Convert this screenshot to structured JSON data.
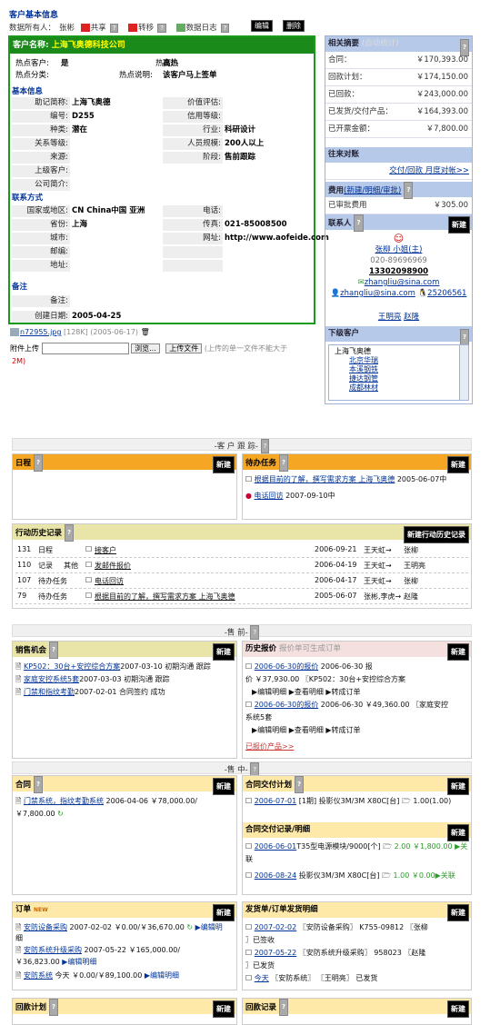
{
  "title": "客户基本信息",
  "topbar": {
    "owner_label": "数据所有人：",
    "owner": "张彬",
    "share": "共享",
    "transfer": "转移",
    "log": "数据日志",
    "edit": "编辑",
    "delete": "删除"
  },
  "customer": {
    "label": "客户名称:",
    "name": "上海飞奥德科技公司",
    "hot_customer_label": "热点客户:",
    "hot_customer": "是",
    "hotness_label": "热度:",
    "hotness": "高热",
    "hot_type_label": "热点分类:",
    "hot_desc_label": "热点说明:",
    "hot_desc": "该客户马上签单",
    "basic_title": "基本信息",
    "basic": [
      [
        "助记简称:",
        "上海飞奥德",
        "价值评估:",
        ""
      ],
      [
        "编号:",
        "D255",
        "信用等级:",
        ""
      ],
      [
        "种类:",
        "潜在",
        "行业:",
        "科研设计"
      ],
      [
        "关系等级:",
        "",
        "人员规模:",
        "200人以上"
      ],
      [
        "来源:",
        "",
        "阶段:",
        "售前跟踪"
      ],
      [
        "上级客户:",
        "",
        "",
        ""
      ],
      [
        "公司简介:",
        "",
        "",
        ""
      ]
    ],
    "contact_title": "联系方式",
    "contact": [
      [
        "国家或地区:",
        "CN China中国  亚洲",
        "电话:",
        ""
      ],
      [
        "省份:",
        "上海",
        "传真:",
        "021-85008500"
      ],
      [
        "城市:",
        "",
        "网址:",
        "http://www.aofeide.com"
      ],
      [
        "邮编:",
        "",
        "",
        ""
      ],
      [
        "地址:",
        "",
        "",
        ""
      ]
    ],
    "note_title": "备注",
    "note_label": "备注:",
    "created_label": "创建日期:",
    "created": "2005-04-25"
  },
  "attachment": {
    "file": "n72955.jpg",
    "meta": "[128K] (2005-06-17)",
    "upload_label": "附件上传",
    "browse": "浏览...",
    "upload_btn": "上传文件",
    "hint": "(上传的单一文件不能大于",
    "hint2": "2M)"
  },
  "side": {
    "summary_title": "相关摘要",
    "summary_sub": "(自动统计)",
    "summary": [
      [
        "合同：",
        "￥170,393.00"
      ],
      [
        "回款计划：",
        "￥174,150.00"
      ],
      [
        "已回款：",
        "￥243,000.00"
      ],
      [
        "已发货/交付产品：",
        "￥164,393.00"
      ],
      [
        "已开票金额：",
        "￥7,800.00"
      ]
    ],
    "contact_title": "往来对账",
    "contact_link": "交付/回款  月度对帐>>",
    "fee_title": "费用",
    "fee_sub": "(新建/明细/审批)",
    "fee_label": "已审批费用",
    "fee_value": "￥305.00",
    "person_title": "联系人",
    "new": "新建",
    "person_name": "张柳  小姐(主)",
    "phone1": "020-89696969",
    "phone2": "13302098900",
    "email1": "zhangliu@sina.com",
    "email2": "zhangliu@sina.com",
    "qq": "25206561",
    "other1": "王明亮",
    "other2": "赵隆",
    "sub_title": "下级客户",
    "tree": [
      "上海飞奥德",
      "北京华瑞",
      "本溪钢铁",
      "捷达钢管",
      "成都林材"
    ]
  },
  "sections": {
    "follow": "-客 户 跟 踪-",
    "pre": "-售 前-",
    "mid": "-售 中-"
  },
  "schedule": {
    "title": "日程",
    "new": "新建"
  },
  "todo": {
    "title": "待办任务",
    "new": "新建",
    "items": [
      [
        "根据目前的了解，撰写需求方案 上海飞奥德",
        "2005-06-07中"
      ],
      [
        "电话回访",
        "2007-09-10中"
      ]
    ]
  },
  "history": {
    "title": "行动历史记录",
    "new": "新建行动历史记录",
    "rows": [
      [
        "131",
        "日程",
        "",
        "接客户",
        "2006-09-21",
        "王天虹→",
        "张柳"
      ],
      [
        "110",
        "记录",
        "其他",
        "发邮件报价",
        "2006-04-19",
        "王天虹→",
        "王明亮"
      ],
      [
        "107",
        "待办任务",
        "",
        "电话回访",
        "2006-04-17",
        "王天虹→",
        "张柳"
      ],
      [
        "79",
        "待办任务",
        "",
        "根据目前的了解，撰写需求方案  上海飞奥德",
        "2005-06-07",
        "张彬,李虎→",
        "赵隆"
      ]
    ]
  },
  "opportunity": {
    "title": "销售机会",
    "new": "新建",
    "items": [
      [
        "KP502：30台+安控综合方案",
        "2007-03-10 初期沟通 跟踪"
      ],
      [
        "家庭安控系统5套",
        "2007-03-03 初期沟通 跟踪"
      ],
      [
        "门禁和指纹考勤",
        "2007-02-01 合同签约 成功"
      ]
    ]
  },
  "quote": {
    "title": "历史报价",
    "sub": "报价单可生成订单",
    "new": "新建",
    "l1": "2006-06-30的报价",
    "l1b": "2006-06-30 报",
    "l2": "价 ￥37,930.00 〖KP502：30台+安控综合方案",
    "l3": "▶编辑明细 ▶查看明细 ▶转成订单",
    "l4": "2006-06-30的报价",
    "l4b": "2006-06-30 ￥49,360.00 〖家庭安控",
    "l5": "系统5套",
    "l6": "▶编辑明细 ▶查看明细 ▶转成订单",
    "more": "已报价产品>>"
  },
  "contract": {
    "title": "合同",
    "new": "新建",
    "l1": "门禁系统，指纹考勤系统",
    "l1b": "2006-04-06 ￥78,000.00/",
    "l2": "￥7,800.00"
  },
  "plan": {
    "title": "合同交付计划",
    "new": "新建",
    "l1": "2006-07-01",
    "l1b": "[1期] 投影仪3M/3M X80C[台]",
    "l1c": "1.00(1.00)",
    "rec_title": "合同交付记录/明细",
    "r1": "2006-06-01",
    "r1b": "T35型电源模块/9000[个]",
    "r1c": "2.00 ￥1,800.00 ▶关",
    "r1d": "联",
    "r2": "2006-08-24",
    "r2b": "投影仪3M/3M X80C[台]",
    "r2c": "1.00 ￥0.00▶关联"
  },
  "order": {
    "title": "订单",
    "badge": "NEW",
    "new": "新建",
    "l1": "安防设备采购",
    "l1b": "2007-02-02 ￥0.00/￥36,670.00",
    "l1c": "▶编辑明",
    "l1d": "细",
    "l2": "安防系统升级采购",
    "l2b": "2007-05-22 ￥165,000.00/",
    "l3": "￥36,823.00",
    "l3b": "▶编辑明细",
    "l4": "安防系统",
    "l4b": "今天 ￥0.00/￥89,100.00",
    "l4c": "▶编辑明细"
  },
  "ship": {
    "title": "发货单/订单发货明细",
    "new": "新建",
    "l1": "2007-02-02",
    "l1b": "〖安防设备采购〗 K755-09812 〖张柳",
    "l2": "〗已签收",
    "l3": "2007-05-22",
    "l3b": "〖安防系统升级采购〗 958023 〖赵隆",
    "l4": "〗已发货",
    "l5": "今天",
    "l5b": "〖安防系统〗 〖王明亮〗 已发货"
  },
  "payplan": {
    "title": "回款计划",
    "new": "新建"
  },
  "payrec": {
    "title": "回款记录",
    "new": "新建"
  }
}
